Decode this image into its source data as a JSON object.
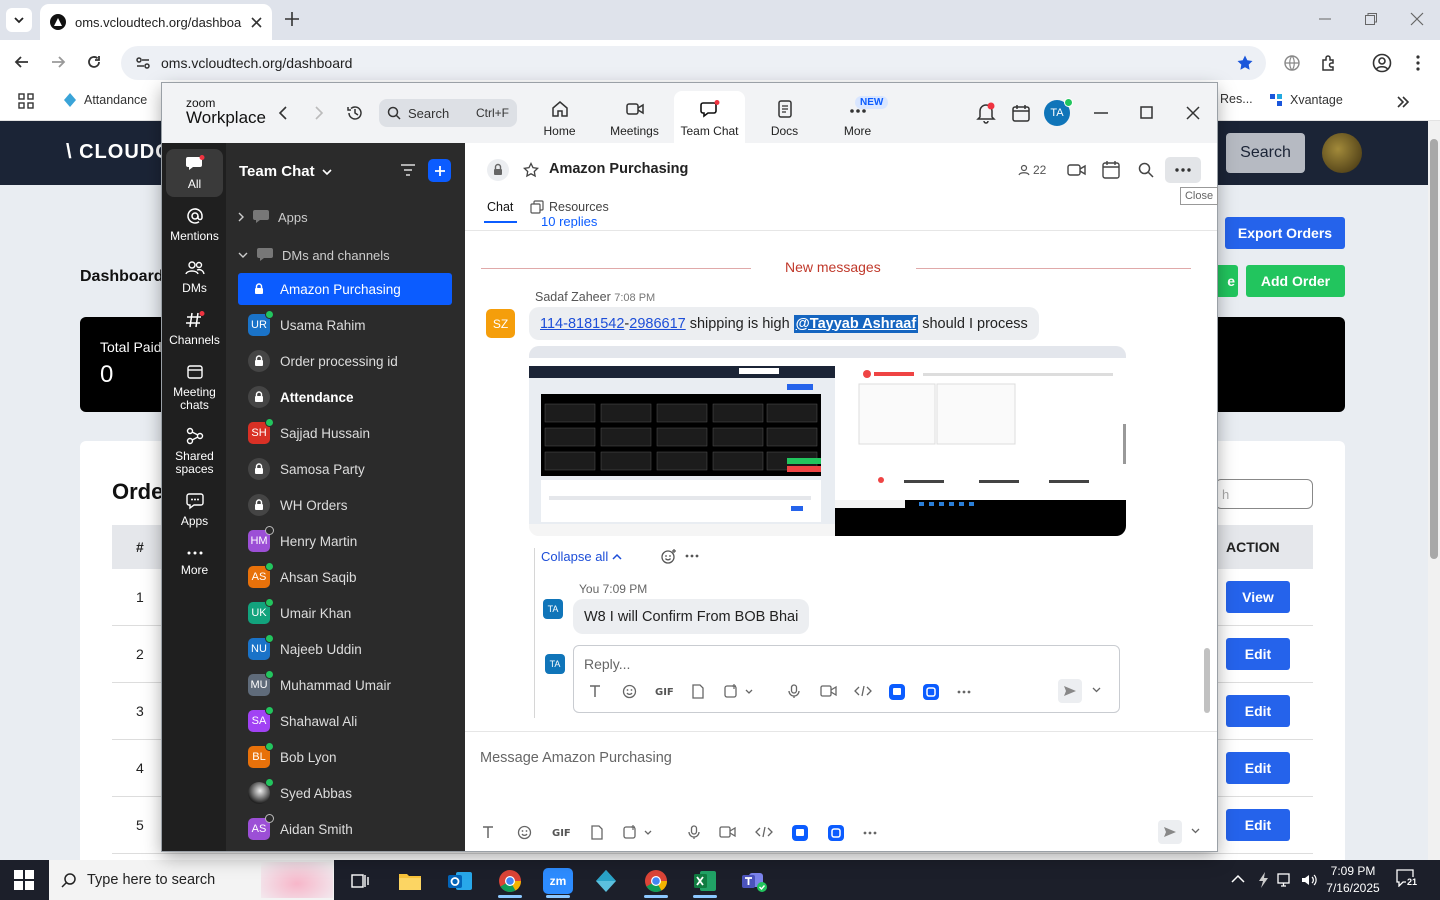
{
  "browser": {
    "tab_title": "oms.vcloudtech.org/dashboard",
    "url": "oms.vcloudtech.org/dashboard",
    "bookmarks": [
      {
        "label": "Attandance"
      },
      {
        "label": "Res..."
      },
      {
        "label": "Xvantage"
      }
    ]
  },
  "webpage": {
    "logo_text": "\\ CLOUDC",
    "search_button": "Search",
    "dashboard_title": "Dashboard",
    "export_button": "Export Orders",
    "green_button_partial": "e",
    "add_order_button": "Add Order",
    "stat_label": "Total Paid",
    "stat_value": "0",
    "orders_heading": "Orde",
    "orders_search_placeholder": "h",
    "table_headers": {
      "num": "#",
      "action": "ACTION"
    },
    "rows": [
      {
        "num": "1",
        "action": "View"
      },
      {
        "num": "2",
        "action": "Edit"
      },
      {
        "num": "3",
        "action": "Edit"
      },
      {
        "num": "4",
        "action": "Edit"
      },
      {
        "num": "5",
        "action": "Edit"
      }
    ],
    "close_tooltip": "Close"
  },
  "zoom": {
    "brand_top": "zoom",
    "brand_bottom": "Workplace",
    "search_label": "Search",
    "search_shortcut": "Ctrl+F",
    "nav_tabs": [
      {
        "label": "Home"
      },
      {
        "label": "Meetings"
      },
      {
        "label": "Team Chat"
      },
      {
        "label": "Docs"
      },
      {
        "label": "More"
      }
    ],
    "new_badge": "NEW",
    "user_initials": "TA",
    "rail": [
      {
        "label": "All"
      },
      {
        "label": "Mentions"
      },
      {
        "label": "DMs"
      },
      {
        "label": "Channels"
      },
      {
        "label": "Meeting chats"
      },
      {
        "label": "Shared spaces"
      },
      {
        "label": "Apps"
      },
      {
        "label": "More"
      }
    ],
    "sidebar": {
      "title": "Team Chat",
      "sections": {
        "apps": "Apps",
        "dms": "DMs and channels"
      },
      "items": [
        {
          "name": "Amazon Purchasing",
          "type": "channel",
          "selected": true
        },
        {
          "name": "Usama Rahim",
          "type": "user",
          "initials": "UR",
          "color": "#1a73c8",
          "presence": "online"
        },
        {
          "name": "Order processing id",
          "type": "channel"
        },
        {
          "name": "Attendance",
          "type": "channel",
          "bold": true
        },
        {
          "name": "Sajjad Hussain",
          "type": "user",
          "initials": "SH",
          "color": "#d93025",
          "presence": "online"
        },
        {
          "name": "Samosa Party",
          "type": "channel"
        },
        {
          "name": "WH Orders",
          "type": "channel"
        },
        {
          "name": "Henry Martin",
          "type": "user",
          "initials": "HM",
          "color": "#9c4fd6",
          "presence": "away"
        },
        {
          "name": "Ahsan Saqib",
          "type": "user",
          "initials": "AS",
          "color": "#e8710a",
          "presence": "online"
        },
        {
          "name": "Umair Khan",
          "type": "user",
          "initials": "UK",
          "color": "#12a37d",
          "presence": "online"
        },
        {
          "name": "Najeeb Uddin",
          "type": "user",
          "initials": "NU",
          "color": "#1a73c8",
          "presence": "online"
        },
        {
          "name": "Muhammad Umair",
          "type": "user",
          "initials": "MU",
          "color": "#5f6b7a",
          "presence": "online"
        },
        {
          "name": "Shahawal Ali",
          "type": "user",
          "initials": "SA",
          "color": "#a142f4",
          "presence": "online"
        },
        {
          "name": "Bob Lyon",
          "type": "user",
          "initials": "BL",
          "color": "#e8710a",
          "presence": "online"
        },
        {
          "name": "Syed Abbas",
          "type": "user",
          "initials": "",
          "color": "#3a3a3a",
          "presence": "online"
        },
        {
          "name": "Aidan Smith",
          "type": "user",
          "initials": "AS",
          "color": "#9c4fd6",
          "presence": "away"
        }
      ]
    },
    "chat": {
      "channel_name": "Amazon Purchasing",
      "member_count": "22",
      "tabs": {
        "chat": "Chat",
        "resources": "Resources"
      },
      "replies_partial": "10 replies",
      "new_messages": "New messages",
      "message1": {
        "sender": "Sadaf Zaheer",
        "time": "7:08 PM",
        "initials": "SZ",
        "link1": "114-8181542",
        "dash": "-",
        "link2": "2986617",
        "text_mid": "shipping is high",
        "mention": "@Tayyab Ashraaf",
        "text_end": "should I process"
      },
      "collapse_all": "Collapse all",
      "reply": {
        "sender": "You",
        "time": "7:09 PM",
        "initials": "TA",
        "text": "W8 I will Confirm From BOB Bhai"
      },
      "reply_placeholder": "Reply...",
      "composer_placeholder": "Message Amazon Purchasing"
    }
  },
  "taskbar": {
    "search_placeholder": "Type here to search",
    "time": "7:09 PM",
    "date": "7/16/2025",
    "notification_count": "21"
  }
}
